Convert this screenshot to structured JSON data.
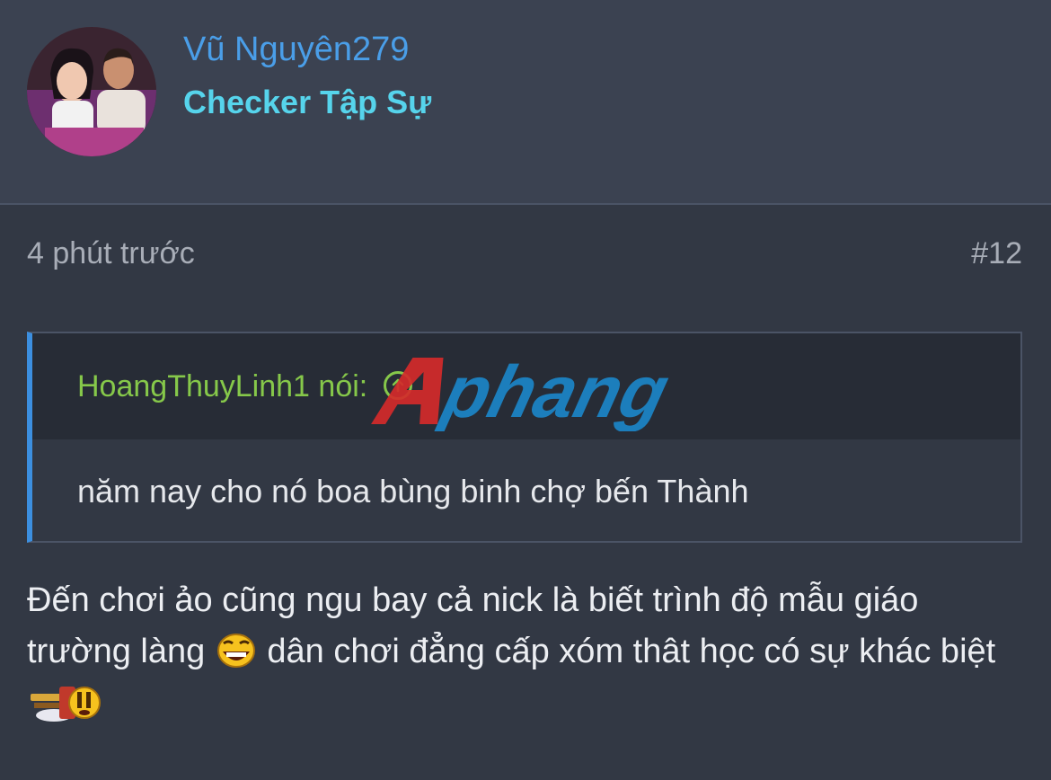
{
  "post": {
    "author": {
      "name": "Vũ Nguyên279",
      "title": "Checker Tập Sự",
      "avatar_icon": "user-avatar-photo"
    },
    "time": "4 phút trước",
    "number": "#12",
    "quote": {
      "author": "HoangThuyLinh1",
      "said": "nói:",
      "jump_icon": "arrow-up-circle-icon",
      "text": "năm nay cho nó boa bùng binh chợ bến Thành"
    },
    "message": {
      "part1": "Đến chơi ảo cũng ngu bay cả nick là biết trình độ mẫu giáo trường làng",
      "part2": "dân chơi đẳng cấp xóm thât học có sự khác biệt",
      "emoji1": "laughing-emoji",
      "emoji2": "slam-emoji"
    },
    "watermark": "Aphang"
  },
  "colors": {
    "background": "#323844",
    "header_background": "#3b4251",
    "username": "#4a9ee8",
    "user_title": "#56d4ec",
    "quote_border": "#3c8fe0",
    "quote_author": "#86c84a",
    "meta_text": "#a8adb7"
  }
}
